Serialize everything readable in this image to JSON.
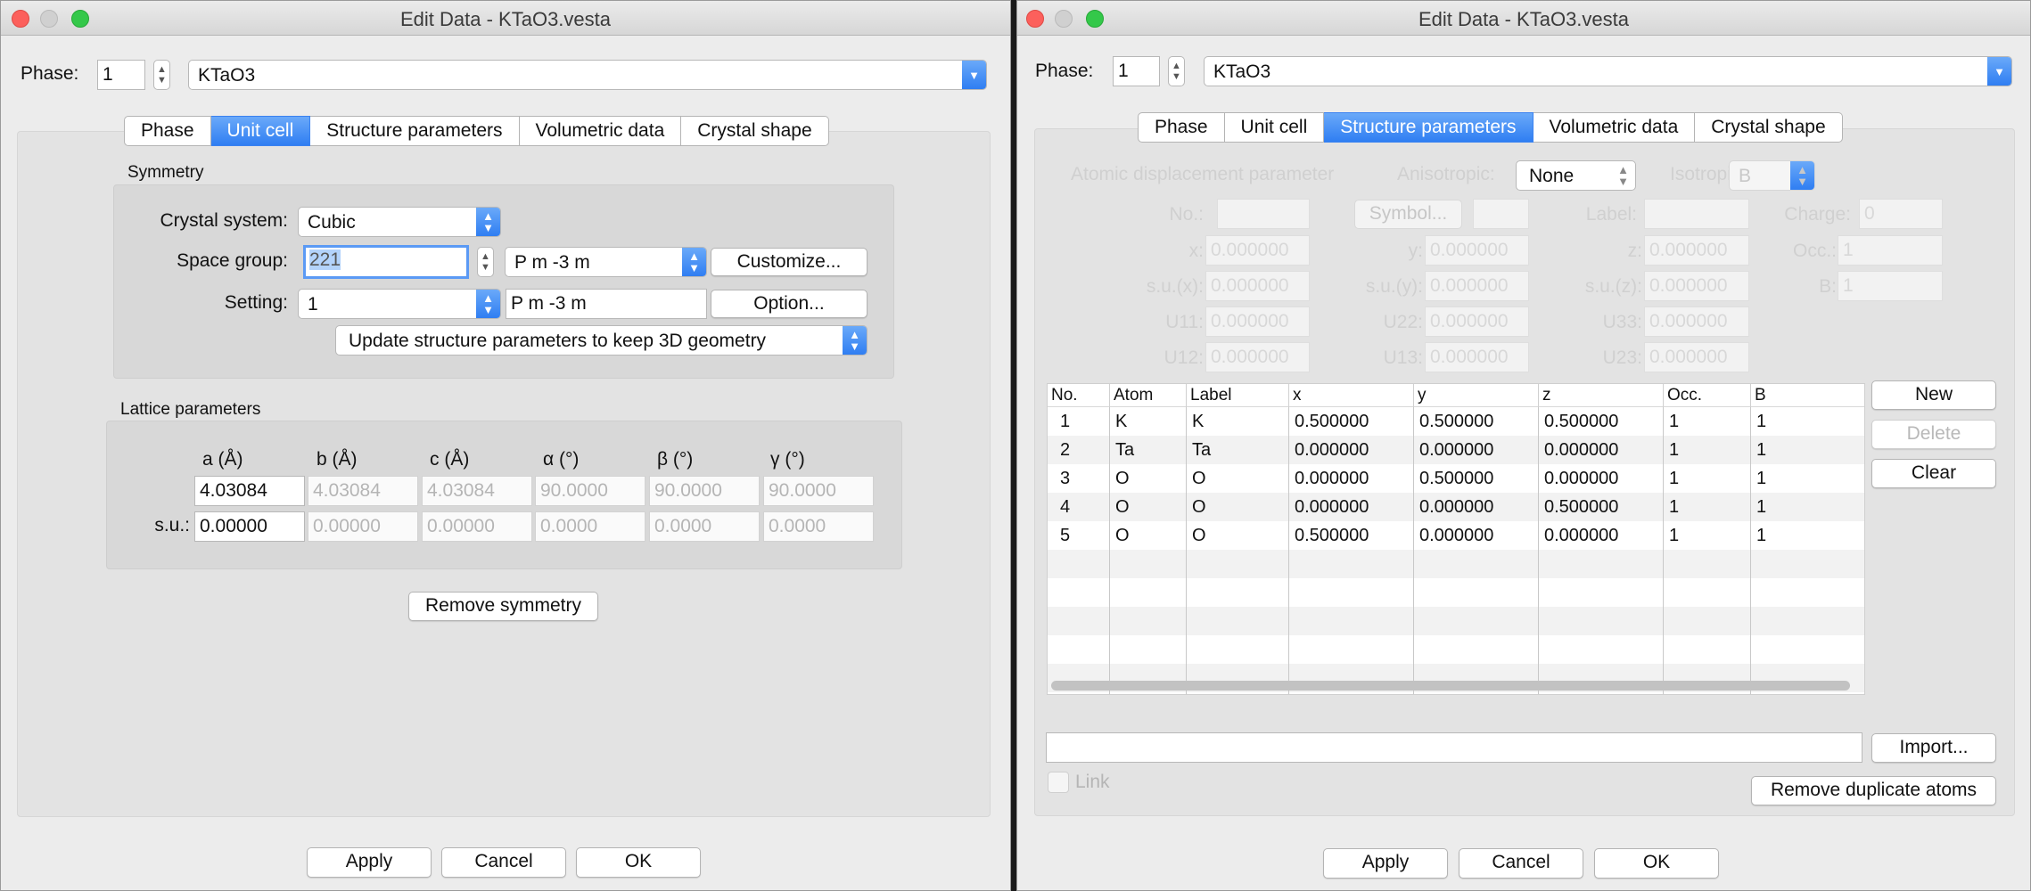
{
  "windows": [
    {
      "title": "Edit Data - KTaO3.vesta",
      "phase_label": "Phase:",
      "phase_number": "1",
      "phase_name": "KTaO3",
      "tabs": [
        "Phase",
        "Unit cell",
        "Structure parameters",
        "Volumetric data",
        "Crystal shape"
      ],
      "active_tab": "Unit cell",
      "symmetry": {
        "title": "Symmetry",
        "crystal_system_label": "Crystal system:",
        "crystal_system": "Cubic",
        "space_group_label": "Space group:",
        "space_group_number": "221",
        "space_group_symbol": "P m -3 m",
        "customize_button": "Customize...",
        "setting_label": "Setting:",
        "setting_value": "1",
        "setting_symbol": "P m -3 m",
        "option_button": "Option...",
        "update_option": "Update structure parameters to keep 3D geometry"
      },
      "lattice": {
        "title": "Lattice parameters",
        "headers": [
          "a (Å)",
          "b (Å)",
          "c (Å)",
          "α (°)",
          "β (°)",
          "γ (°)"
        ],
        "values": [
          "4.03084",
          "4.03084",
          "4.03084",
          "90.0000",
          "90.0000",
          "90.0000"
        ],
        "su_label": "s.u.:",
        "su_values": [
          "0.00000",
          "0.00000",
          "0.00000",
          "0.0000",
          "0.0000",
          "0.0000"
        ]
      },
      "remove_symmetry_button": "Remove symmetry",
      "footer": {
        "apply": "Apply",
        "cancel": "Cancel",
        "ok": "OK"
      }
    },
    {
      "title": "Edit Data - KTaO3.vesta",
      "phase_label": "Phase:",
      "phase_number": "1",
      "phase_name": "KTaO3",
      "tabs": [
        "Phase",
        "Unit cell",
        "Structure parameters",
        "Volumetric data",
        "Crystal shape"
      ],
      "active_tab": "Structure parameters",
      "adp": {
        "label": "Atomic displacement parameter",
        "anisotropic_label": "Anisotropic:",
        "anisotropic_value": "None",
        "isotropic_label": "Isotropic:",
        "isotropic_value": "B"
      },
      "atom_form": {
        "no_label": "No.:",
        "symbol_button": "Symbol...",
        "label_label": "Label:",
        "charge_label": "Charge:",
        "charge_value": "0",
        "x_label": "x:",
        "x_value": "0.000000",
        "y_label": "y:",
        "y_value": "0.000000",
        "z_label": "z:",
        "z_value": "0.000000",
        "occ_label": "Occ.:",
        "occ_value": "1",
        "sux_label": "s.u.(x):",
        "sux_value": "0.000000",
        "suy_label": "s.u.(y):",
        "suy_value": "0.000000",
        "suz_label": "s.u.(z):",
        "suz_value": "0.000000",
        "b_label": "B:",
        "b_value": "1",
        "u11_label": "U11:",
        "u11_value": "0.000000",
        "u22_label": "U22:",
        "u22_value": "0.000000",
        "u33_label": "U33:",
        "u33_value": "0.000000",
        "u12_label": "U12:",
        "u12_value": "0.000000",
        "u13_label": "U13:",
        "u13_value": "0.000000",
        "u23_label": "U23:",
        "u23_value": "0.000000"
      },
      "table": {
        "headers": [
          "No.",
          "Atom",
          "Label",
          "x",
          "y",
          "z",
          "Occ.",
          "B"
        ],
        "rows": [
          [
            "1",
            "K",
            "K",
            "0.500000",
            "0.500000",
            "0.500000",
            "1",
            "1"
          ],
          [
            "2",
            "Ta",
            "Ta",
            "0.000000",
            "0.000000",
            "0.000000",
            "1",
            "1"
          ],
          [
            "3",
            "O",
            "O",
            "0.000000",
            "0.500000",
            "0.000000",
            "1",
            "1"
          ],
          [
            "4",
            "O",
            "O",
            "0.000000",
            "0.000000",
            "0.500000",
            "1",
            "1"
          ],
          [
            "5",
            "O",
            "O",
            "0.500000",
            "0.000000",
            "0.000000",
            "1",
            "1"
          ]
        ]
      },
      "side_buttons": {
        "new": "New",
        "delete": "Delete",
        "clear": "Clear"
      },
      "import_button": "Import...",
      "link_label": "Link",
      "remove_duplicates_button": "Remove duplicate atoms",
      "footer": {
        "apply": "Apply",
        "cancel": "Cancel",
        "ok": "OK"
      }
    }
  ]
}
